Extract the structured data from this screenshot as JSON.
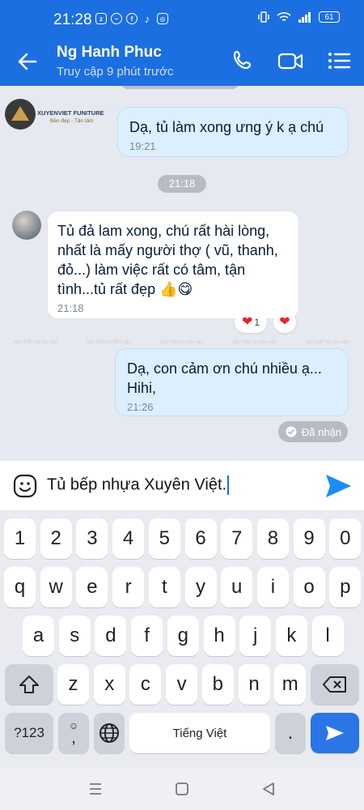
{
  "status": {
    "time": "21:28",
    "battery": "61",
    "apps": [
      "Zalo",
      "Messenger",
      "Facebook",
      "TikTok",
      "Instagram"
    ]
  },
  "header": {
    "title": "Ng Hanh Phuc",
    "subtitle": "Truy cập 9 phút trước",
    "icons": [
      "back-arrow-icon",
      "phone-icon",
      "video-icon",
      "menu-list-icon"
    ]
  },
  "chat": {
    "logo": {
      "name": "XUYENVIET FUNITURE",
      "tagline": "Bền đẹp - Tận tâm"
    },
    "date_separator": "21:18",
    "messages": [
      {
        "from": "me",
        "text": "Dạ, tủ làm xong ưng ý k ạ chú",
        "time": "19:21"
      },
      {
        "from": "them",
        "text": "Tủ đả lam xong, chú rất hài lòng, nhất là mấy người thợ  ( vũ, thanh, đỏ...) làm việc rất  có tâm, tận tình...tủ rất đẹp 👍😋",
        "time": "21:18",
        "reactions": [
          {
            "emoji": "❤",
            "count": "1"
          },
          {
            "emoji": "❤",
            "count": ""
          }
        ]
      },
      {
        "from": "me",
        "text": "Dạ, con cảm ơn chú nhiều ạ... Hihi,",
        "time": "21:26"
      }
    ],
    "watermark": "NỘI THẤT XUYÊN VIỆT",
    "delivered": "Đã nhận"
  },
  "composer": {
    "value": "Tủ bếp nhựa Xuyên Việt."
  },
  "keyboard": {
    "row_numbers": [
      "1",
      "2",
      "3",
      "4",
      "5",
      "6",
      "7",
      "8",
      "9",
      "0"
    ],
    "row1": [
      "q",
      "w",
      "e",
      "r",
      "t",
      "y",
      "u",
      "i",
      "o",
      "p"
    ],
    "row2": [
      "a",
      "s",
      "d",
      "f",
      "g",
      "h",
      "j",
      "k",
      "l"
    ],
    "row3": [
      "z",
      "x",
      "c",
      "v",
      "b",
      "n",
      "m"
    ],
    "symbols_label": "?123",
    "comma": ",",
    "space_label": "Tiếng Việt",
    "period": "."
  },
  "colors": {
    "brand": "#1b6fe0",
    "my_bubble": "#dcefff",
    "heart": "#e5232e",
    "send": "#2a76e6"
  }
}
